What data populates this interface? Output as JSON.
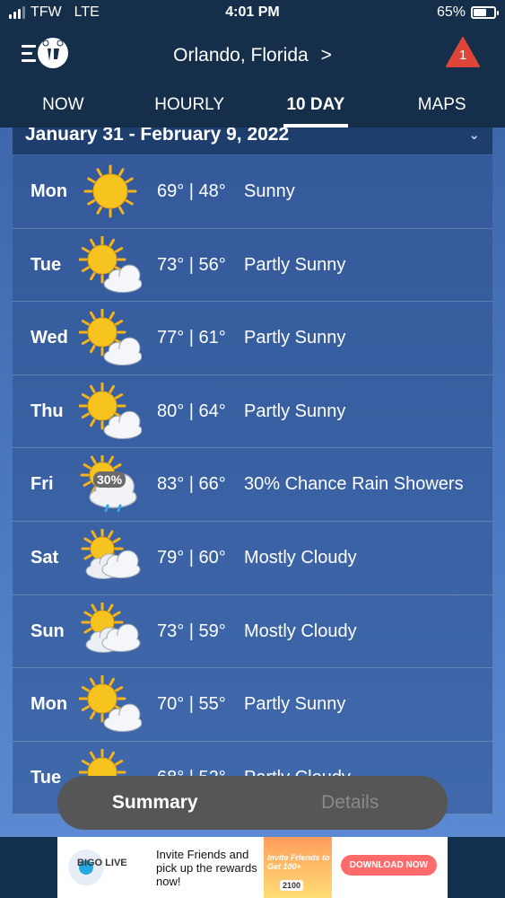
{
  "status": {
    "carrier": "TFW",
    "network": "LTE",
    "time": "4:01 PM",
    "battery_percent": "65%",
    "battery_level": 0.65,
    "signal_bars_filled": 3
  },
  "header": {
    "location": "Orlando, Florida",
    "location_chevron": ">",
    "alert_count": "1",
    "logo_text": "TW"
  },
  "tabs": [
    {
      "label": "NOW",
      "active": false
    },
    {
      "label": "HOURLY",
      "active": false
    },
    {
      "label": "10 DAY",
      "active": true
    },
    {
      "label": "MAPS",
      "active": false
    }
  ],
  "date_range": "January 31 - February 9, 2022",
  "forecast": [
    {
      "day": "Mon",
      "icon": "sunny-icon",
      "temps": "69° | 48°",
      "condition": "Sunny"
    },
    {
      "day": "Tue",
      "icon": "partly-sunny-icon",
      "temps": "73° | 56°",
      "condition": "Partly Sunny"
    },
    {
      "day": "Wed",
      "icon": "partly-sunny-icon",
      "temps": "77° | 61°",
      "condition": "Partly Sunny"
    },
    {
      "day": "Thu",
      "icon": "partly-sunny-icon",
      "temps": "80° | 64°",
      "condition": "Partly Sunny"
    },
    {
      "day": "Fri",
      "icon": "rain-showers-icon",
      "precip": "30%",
      "temps": "83° | 66°",
      "condition": "30% Chance Rain Showers"
    },
    {
      "day": "Sat",
      "icon": "mostly-cloudy-icon",
      "temps": "79° | 60°",
      "condition": "Mostly Cloudy"
    },
    {
      "day": "Sun",
      "icon": "mostly-cloudy-icon",
      "temps": "73° | 59°",
      "condition": "Mostly Cloudy"
    },
    {
      "day": "Mon",
      "icon": "partly-sunny-icon",
      "temps": "70° | 55°",
      "condition": "Partly Sunny"
    },
    {
      "day": "Tue",
      "icon": "partly-sunny-icon",
      "temps": "68° | 52°",
      "condition": "Partly Cloudy"
    }
  ],
  "segmented": {
    "summary": "Summary",
    "details": "Details"
  },
  "ad": {
    "brand": "BIGO LIVE",
    "text": "Invite Friends and pick up the rewards now!",
    "promo_top": "Invite Friends to Get 100+",
    "promo_amount": "2100",
    "cta": "DOWNLOAD NOW"
  },
  "colors": {
    "accent": "#152f4a",
    "alert": "#e0453a",
    "row_bg": "#2c4e8c"
  }
}
